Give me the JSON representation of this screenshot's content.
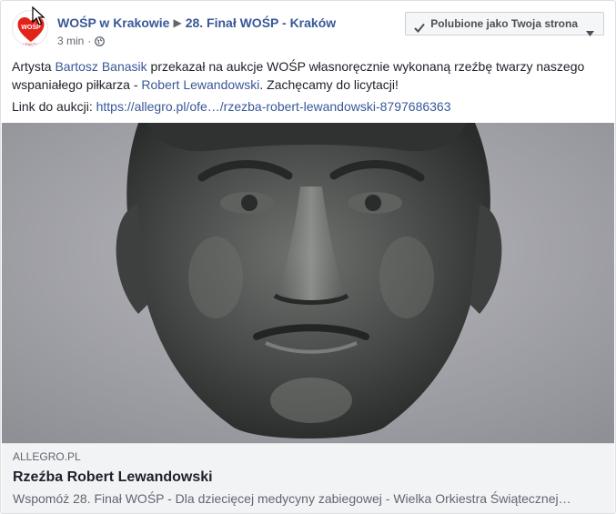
{
  "post": {
    "page_name": "WOŚP w Krakowie",
    "event_name": "28. Finał WOŚP - Kraków",
    "separator_icon": "triangle-right-icon",
    "timestamp": "3 min",
    "meta_separator": "·",
    "privacy_icon": "globe-icon",
    "avatar_text": "WOŚP",
    "avatar_subtext": "KRAKÓW",
    "liked_button": {
      "label": "Polubione jako Twoja strona",
      "check_icon": "check-icon",
      "caret_icon": "caret-down-icon"
    },
    "text": {
      "part1": "Artysta ",
      "mention1": "Bartosz Banasik",
      "part2": " przekazał na aukcje WOŚP własnoręcznie wykonaną rzeźbę twarzy naszego wspaniałego piłkarza - ",
      "mention2": "Robert Lewandowski",
      "part3": ". Zachęcamy do licytacji!"
    },
    "link_line": {
      "prefix": "Link do aukcji: ",
      "url": "https://allegro.pl/ofe…/rzezba-robert-lewandowski-8797686363"
    },
    "image": {
      "alt": "Rzeźba twarzy Roberta Lewandowskiego"
    },
    "card": {
      "domain": "ALLEGRO.PL",
      "title": "Rzeźba Robert Lewandowski",
      "description": "Wspomóż 28. Finał WOŚP - Dla dziecięcej medycyny zabiegowej - Wielka Orkiestra Świątecznej…"
    }
  },
  "colors": {
    "link": "#385898",
    "text": "#1d2129",
    "secondary": "#606770",
    "card_bg": "#f2f3f5",
    "brand_red": "#e2231a"
  }
}
